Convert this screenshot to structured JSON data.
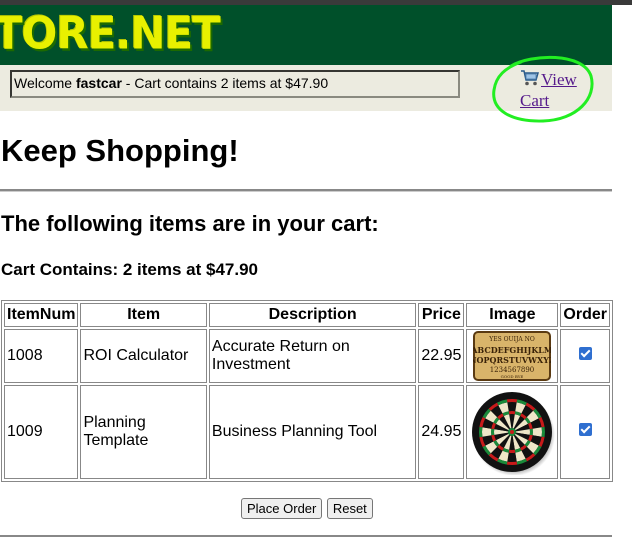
{
  "header": {
    "logo_text": "TORE.NET",
    "welcome_prefix": "Welcome ",
    "username": "fastcar",
    "welcome_suffix": " - Cart contains 2 items at $47.90",
    "view_cart_label": "View Cart",
    "cart_icon": "shopping-cart-icon"
  },
  "page": {
    "title": "Keep Shopping!",
    "subtitle": "The following items are in your cart:",
    "cart_summary": "Cart Contains: 2 items at $47.90"
  },
  "table": {
    "columns": [
      "ItemNum",
      "Item",
      "Description",
      "Price",
      "Image",
      "Order"
    ],
    "rows": [
      {
        "item_num": "1008",
        "item": "ROI Calculator",
        "description": "Accurate Return on Investment",
        "price": "22.95",
        "image": "ouija-board-image",
        "ordered": true
      },
      {
        "item_num": "1009",
        "item": "Planning Template",
        "description": "Business Planning Tool",
        "price": "24.95",
        "image": "dartboard-image",
        "ordered": true
      }
    ]
  },
  "actions": {
    "place_order_label": "Place Order",
    "reset_label": "Reset"
  },
  "colors": {
    "banner_bg": "#00502a",
    "logo_color": "#e8f000",
    "userbar_bg": "#ecebe0",
    "link_color": "#551a8b",
    "annotation_circle": "#22ee22",
    "checkbox": "#2f6fd0"
  }
}
